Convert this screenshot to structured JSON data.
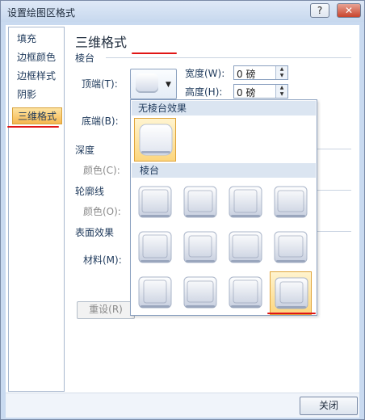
{
  "window": {
    "title": "设置绘图区格式",
    "help_glyph": "?",
    "close_glyph": "✕"
  },
  "nav": {
    "items": [
      {
        "label": "填充"
      },
      {
        "label": "边框颜色"
      },
      {
        "label": "边框样式"
      },
      {
        "label": "阴影"
      },
      {
        "label": "三维格式"
      }
    ],
    "selected_index": 4
  },
  "panel": {
    "heading": "三维格式",
    "bevel_section": "棱台",
    "top_label": "顶端(T):",
    "bottom_label": "底端(B):",
    "width_label": "宽度(W):",
    "height_label": "高度(H):",
    "width_value": "0 磅",
    "height_value": "0 磅",
    "depth_section": "深度",
    "depth_color_label": "颜色(C):",
    "contour_section": "轮廓线",
    "contour_color_label": "颜色(O):",
    "surface_section": "表面效果",
    "material_label": "材料(M):",
    "reset_label": "重设(R)"
  },
  "gallery": {
    "no_bevel_header": "无棱台效果",
    "bevel_header": "棱台",
    "no_bevel_item": {
      "style": "none",
      "selected": true
    },
    "bevel_items": [
      {
        "style": "circle"
      },
      {
        "style": "relaxed-inset"
      },
      {
        "style": "cross"
      },
      {
        "style": "cool-slant"
      },
      {
        "style": "angle"
      },
      {
        "style": "soft-round"
      },
      {
        "style": "convex"
      },
      {
        "style": "slope"
      },
      {
        "style": "divot"
      },
      {
        "style": "riblet"
      },
      {
        "style": "hard-edge"
      },
      {
        "style": "art-deco",
        "selected": true
      }
    ]
  },
  "footer": {
    "close_label": "关闭"
  },
  "colors": {
    "selection": "#f6b74f",
    "annotation_underline": "#e01515"
  }
}
